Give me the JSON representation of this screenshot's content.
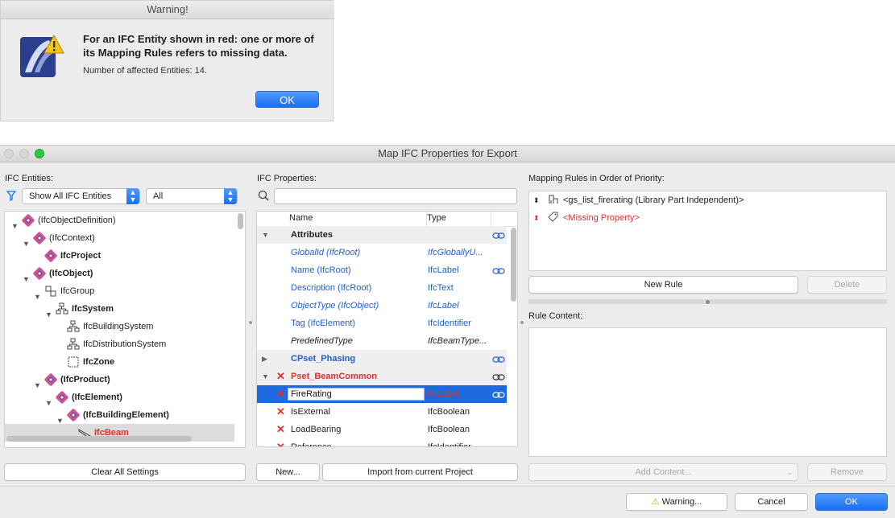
{
  "warning": {
    "title": "Warning!",
    "message": "For an IFC Entity shown in red: one or more of its Mapping Rules refers to missing data.",
    "count": "Number of affected Entities: 14.",
    "ok": "OK"
  },
  "window": {
    "title": "Map IFC Properties for Export",
    "entities_label": "IFC Entities:",
    "filter_select": "Show All IFC Entities",
    "scope_select": "All",
    "clear_button": "Clear All Settings",
    "tree": [
      {
        "label": "(IfcObjectDefinition)",
        "bold": false,
        "red": false,
        "icon": "ifc-class-icon"
      },
      {
        "label": "(IfcContext)",
        "bold": false,
        "red": false,
        "icon": "ifc-class-icon"
      },
      {
        "label": "IfcProject",
        "bold": true,
        "red": false,
        "icon": "ifc-class-icon"
      },
      {
        "label": "(IfcObject)",
        "bold": true,
        "red": false,
        "icon": "ifc-class-icon"
      },
      {
        "label": "IfcGroup",
        "bold": false,
        "red": false,
        "icon": "group-icon"
      },
      {
        "label": "IfcSystem",
        "bold": true,
        "red": false,
        "icon": "system-icon"
      },
      {
        "label": "IfcBuildingSystem",
        "bold": false,
        "red": false,
        "icon": "system-icon"
      },
      {
        "label": "IfcDistributionSystem",
        "bold": false,
        "red": false,
        "icon": "system-icon"
      },
      {
        "label": "IfcZone",
        "bold": true,
        "red": false,
        "icon": "zone-icon"
      },
      {
        "label": "(IfcProduct)",
        "bold": true,
        "red": false,
        "icon": "ifc-class-icon"
      },
      {
        "label": "(IfcElement)",
        "bold": true,
        "red": false,
        "icon": "ifc-class-icon"
      },
      {
        "label": "(IfcBuildingElement)",
        "bold": true,
        "red": false,
        "icon": "ifc-class-icon"
      },
      {
        "label": "IfcBeam",
        "bold": true,
        "red": true,
        "icon": "beam-icon"
      }
    ],
    "properties_label": "IFC Properties:",
    "search_placeholder": "",
    "col_name": "Name",
    "col_type": "Type",
    "properties": [
      {
        "name": "Attributes",
        "type": ""
      },
      {
        "name": "GlobalId (IfcRoot)",
        "type": "IfcGloballyU..."
      },
      {
        "name": "Name (IfcRoot)",
        "type": "IfcLabel"
      },
      {
        "name": "Description (IfcRoot)",
        "type": "IfcText"
      },
      {
        "name": "ObjectType (IfcObject)",
        "type": "IfcLabel"
      },
      {
        "name": "Tag (IfcElement)",
        "type": "IfcIdentifier"
      },
      {
        "name": "PredefinedType",
        "type": "IfcBeamType..."
      },
      {
        "name": "CPset_Phasing",
        "type": ""
      },
      {
        "name": "Pset_BeamCommon",
        "type": ""
      },
      {
        "name": "FireRating",
        "type": "IfcLabel"
      },
      {
        "name": "IsExternal",
        "type": "IfcBoolean"
      },
      {
        "name": "LoadBearing",
        "type": "IfcBoolean"
      },
      {
        "name": "Reference",
        "type": "IfcIdentifier"
      }
    ],
    "new_button": "New...",
    "import_button": "Import from current Project",
    "rules_label": "Mapping Rules in Order of Priority:",
    "rules": [
      {
        "text": "<gs_list_firerating (Library Part Independent)>",
        "red": false
      },
      {
        "text": "<Missing Property>",
        "red": true
      }
    ],
    "new_rule_button": "New Rule",
    "delete_button": "Delete",
    "rule_content_label": "Rule Content:",
    "add_content_button": "Add Content...",
    "remove_button": "Remove",
    "warning_button": "Warning...",
    "cancel_button": "Cancel",
    "ok_button": "OK"
  },
  "colors": {
    "accent": "#1d6ae0",
    "error": "#e0322b",
    "link": "#1f5fd6"
  }
}
